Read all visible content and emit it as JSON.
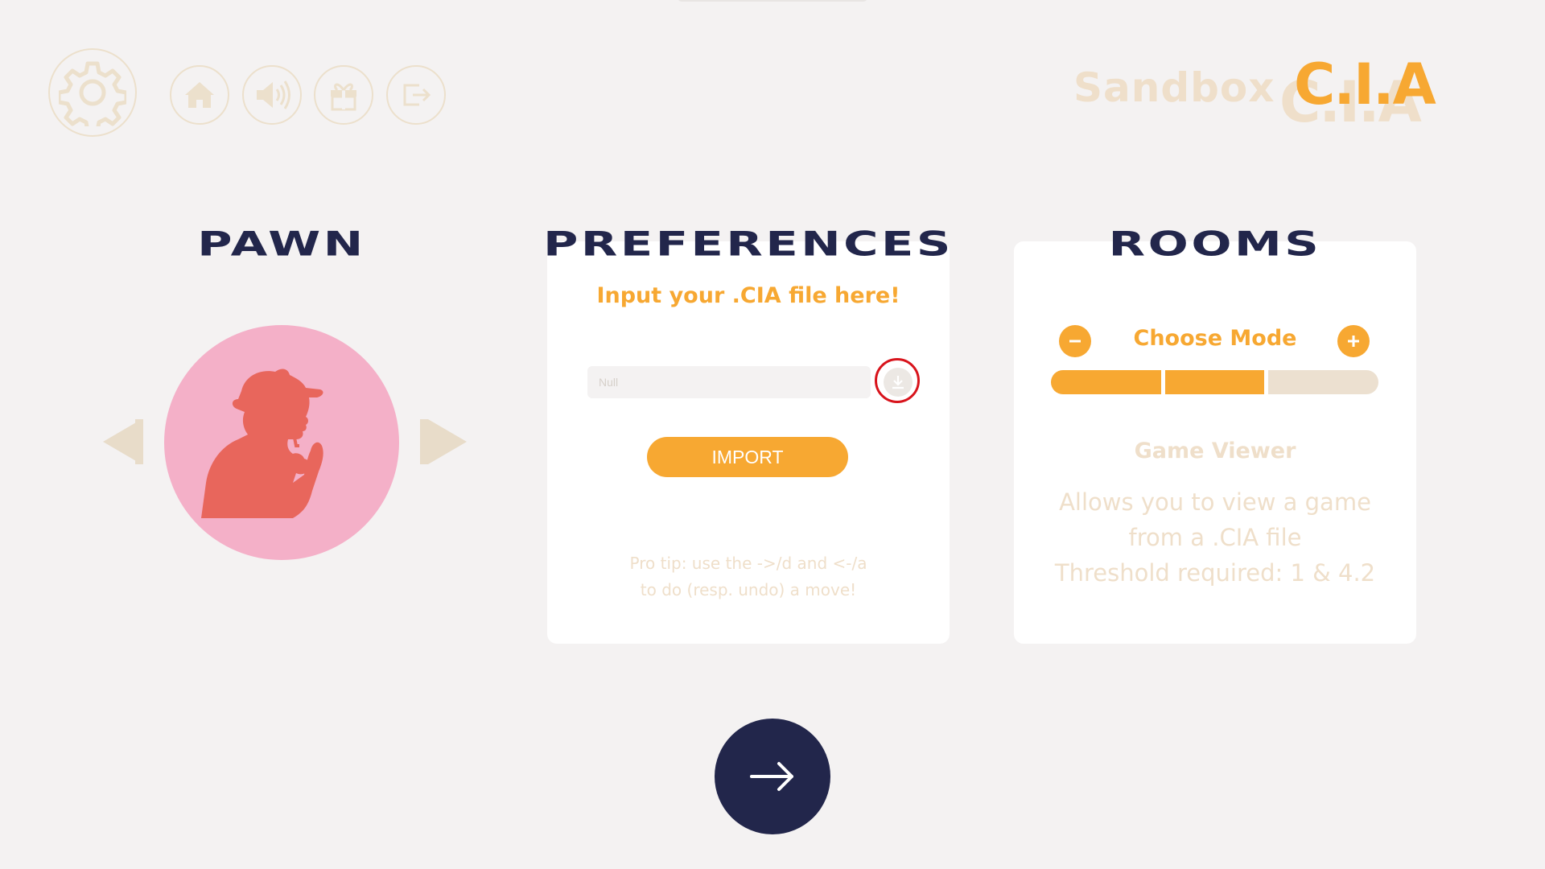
{
  "colors": {
    "navy": "#22264b",
    "orange": "#f7a832",
    "beige": "#efdfca",
    "avatar_bg": "#f4b0c8",
    "avatar_figure": "#e8665c",
    "highlight": "#d8141c"
  },
  "toolbar": {
    "icons": [
      "gear-icon",
      "home-icon",
      "speaker-icon",
      "gift-icon",
      "exit-icon"
    ]
  },
  "brand": {
    "mode": "Sandbox",
    "logo": "C.I.A"
  },
  "pawn": {
    "title": "PAWN",
    "avatar": "detective-silhouette"
  },
  "preferences": {
    "title": "PREFERENCES",
    "heading": "Input your .CIA file here!",
    "input_placeholder": "Null",
    "import_label": "IMPORT",
    "tip_line1": "Pro tip:  use the ->/d and <-/a",
    "tip_line2": "to do (resp. undo) a move!"
  },
  "rooms": {
    "title": "ROOMS",
    "mode_label": "Choose Mode",
    "segments_filled": 2,
    "segments_total": 3,
    "room_name": "Game Viewer",
    "desc_line1": "Allows you to view a game",
    "desc_line2": "from a .CIA file",
    "desc_line3": "Threshold required: 1 & 4.2"
  },
  "next": {
    "icon": "arrow-right-icon"
  }
}
